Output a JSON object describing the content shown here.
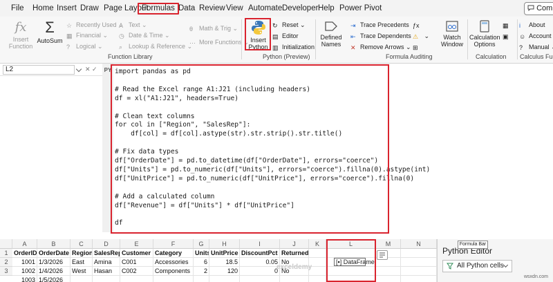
{
  "tabs": [
    {
      "label": "File"
    },
    {
      "label": "Home"
    },
    {
      "label": "Insert"
    },
    {
      "label": "Draw"
    },
    {
      "label": "Page Layout"
    },
    {
      "label": "Formulas"
    },
    {
      "label": "Data"
    },
    {
      "label": "Review"
    },
    {
      "label": "View"
    },
    {
      "label": "Automate"
    },
    {
      "label": "Developer"
    },
    {
      "label": "Help"
    },
    {
      "label": "Power Pivot"
    }
  ],
  "comments_button": "Comm",
  "ribbon": {
    "insert_function": "Insert Function",
    "autosum": "AutoSum",
    "recently_used": "Recently Used",
    "financial": "Financial",
    "logical": "Logical",
    "text": "Text",
    "date_time": "Date & Time",
    "lookup_reference": "Lookup & Reference",
    "math_trig": "Math & Trig",
    "more_functions": "More Functions",
    "function_library": "Function Library",
    "insert_python": "Insert Python",
    "reset": "Reset",
    "editor": "Editor",
    "initialization": "Initialization",
    "python_preview": "Python (Preview)",
    "defined_names": "Defined Names",
    "trace_precedents": "Trace Precedents",
    "trace_dependents": "Trace Dependents",
    "remove_arrows": "Remove Arrows",
    "formula_auditing": "Formula Auditing",
    "watch_window": "Watch Window",
    "calculation_options": "Calculation Options",
    "calculation": "Calculation",
    "about": "About",
    "account": "Account",
    "manual": "Manual",
    "calculus_functions": "Calculus Functio"
  },
  "formula_bar": {
    "name_box": "L2",
    "python_badge": "PY"
  },
  "code": [
    "import pandas as pd",
    "",
    "# Read the Excel range A1:J21 (including headers)",
    "df = xl(\"A1:J21\", headers=True)",
    "",
    "# Clean text columns",
    "for col in [\"Region\", \"SalesRep\"]:",
    "    df[col] = df[col].astype(str).str.strip().str.title()",
    "",
    "# Fix data types",
    "df[\"OrderDate\"] = pd.to_datetime(df[\"OrderDate\"], errors=\"coerce\")",
    "df[\"Units\"] = pd.to_numeric(df[\"Units\"], errors=\"coerce\").fillna(0).astype(int)",
    "df[\"UnitPrice\"] = pd.to_numeric(df[\"UnitPrice\"], errors=\"coerce\").fillna(0)",
    "",
    "# Add a calculated column",
    "df[\"Revenue\"] = df[\"Units\"] * df[\"UnitPrice\"]",
    "",
    "df"
  ],
  "sheet": {
    "columns": [
      "A",
      "B",
      "C",
      "D",
      "E",
      "F",
      "G",
      "H",
      "I",
      "J",
      "K",
      "L",
      "M",
      "N"
    ],
    "row_numbers": [
      "1",
      "2",
      "3"
    ],
    "header": [
      "OrderID",
      "OrderDate",
      "Region",
      "SalesRep",
      "Customer",
      "Category",
      "Units",
      "UnitPrice",
      "DiscountPct",
      "Returned"
    ],
    "rows": [
      [
        "1001",
        "1/3/2026",
        "East",
        "Amina",
        "C001",
        "Accessories",
        "6",
        "18.5",
        "0.05",
        "No"
      ],
      [
        "1002",
        "1/4/2026",
        "West",
        "Hasan",
        "C002",
        "Components",
        "2",
        "120",
        "0",
        "No"
      ],
      [
        "1003",
        "1/5/2026",
        "",
        "",
        "",
        "",
        "",
        "",
        "",
        ""
      ]
    ],
    "python_cell": "DataFrame"
  },
  "python_editor": {
    "title": "Python Editor",
    "tooltip": "Formula Bar",
    "filter": "All Python cells"
  },
  "watermark": "exceldemy",
  "credit": "wsxdn.com"
}
